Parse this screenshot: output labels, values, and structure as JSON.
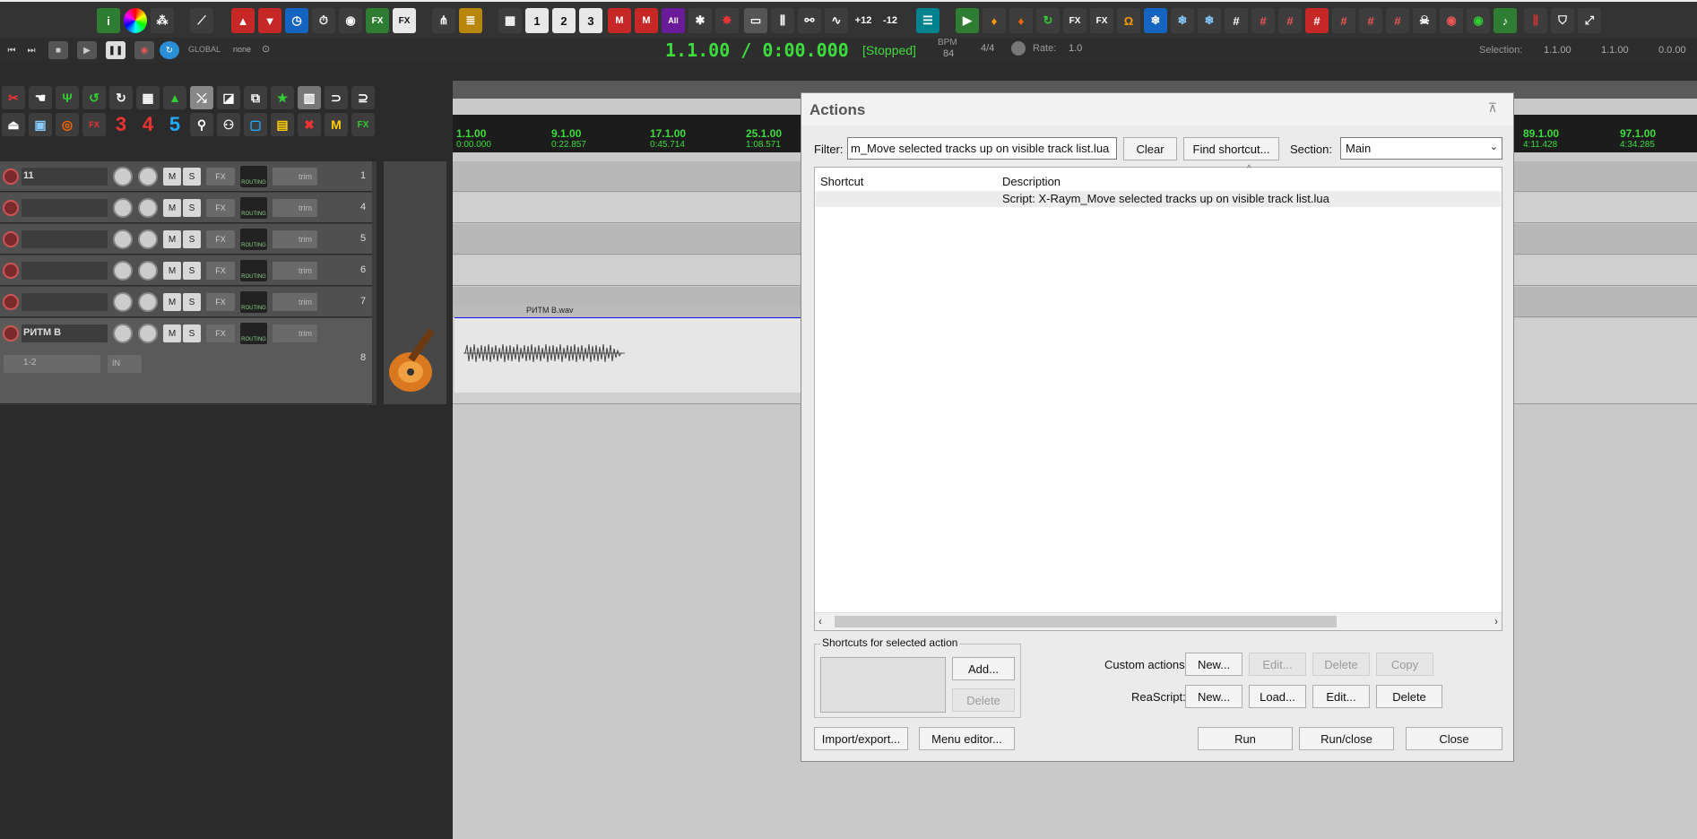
{
  "toolbar": {
    "icons": [
      "info-icon",
      "color-wheel-icon",
      "cluster-icon",
      "envelope-icon",
      "up-arrow-icon",
      "down-arrow-icon",
      "clock-icon",
      "timer-icon",
      "eye-icon",
      "fx-icon",
      "fx-alt-icon",
      "routing-icon",
      "mixer-icon",
      "grid-icon",
      "get-1-icon",
      "get-2-icon",
      "get-3-icon",
      "m-icon",
      "m-x-icon",
      "all-icon",
      "star-x-icon",
      "burst-icon",
      "toggle-icon",
      "fader-icon",
      "link-icon",
      "wave-icon",
      "plus12-icon",
      "minus12-icon",
      "menu-icon",
      "play-green-icon",
      "bell-icon",
      "bell-orange-icon",
      "loop-icon",
      "fx-send-icon",
      "fx-send2-icon",
      "horseshoe-icon",
      "snowflake-icon",
      "snowflake2-icon",
      "snowflake-x-icon",
      "hash-icon",
      "hash1-icon",
      "hash4-icon",
      "hash8-icon",
      "hash16-icon",
      "hash32-icon",
      "hash64-icon",
      "skull-icon",
      "eye-red-icon",
      "eye-green-icon",
      "note-icon",
      "grid-x-icon",
      "shield-icon",
      "expand-icon"
    ],
    "get_labels": [
      "1",
      "2",
      "3"
    ],
    "all_label": "All",
    "plus12": "+12",
    "minus12": "-12"
  },
  "transport": {
    "time": "1.1.00 / 0:00.000",
    "state": "[Stopped]",
    "global_label": "GLOBAL",
    "global_value": "none",
    "bpm_label": "BPM",
    "bpm_value": "84",
    "signature": "4/4",
    "rate_label": "Rate:",
    "rate_value": "1.0",
    "selection_label": "Selection:",
    "selection_start": "1.1.00",
    "selection_end": "1.1.00",
    "selection_length": "0.0.00"
  },
  "second_toolbar": {
    "numbers": [
      "3",
      "4",
      "5"
    ],
    "fx_label": "FX"
  },
  "tracks": [
    {
      "name": "11",
      "number": "1"
    },
    {
      "name": "",
      "number": "4"
    },
    {
      "name": "",
      "number": "5"
    },
    {
      "name": "",
      "number": "6"
    },
    {
      "name": "",
      "number": "7"
    },
    {
      "name": "РИТМ В",
      "number": "8",
      "io": "1-2",
      "in": "IN"
    }
  ],
  "track_buttons": {
    "mute": "M",
    "solo": "S",
    "fx": "FX",
    "routing": "ROUTING",
    "trim": "trim"
  },
  "ruler": {
    "marks": [
      {
        "bar": "1.1.00",
        "time": "0:00.000"
      },
      {
        "bar": "9.1.00",
        "time": "0:22.857"
      },
      {
        "bar": "17.1.00",
        "time": "0:45.714"
      },
      {
        "bar": "25.1.00",
        "time": "1:08.571"
      },
      {
        "bar": "89.1.00",
        "time": "4:11.428"
      },
      {
        "bar": "97.1.00",
        "time": "4:34.285"
      }
    ]
  },
  "media_item": {
    "name": "РИТМ В.wav"
  },
  "actions_dialog": {
    "title": "Actions",
    "filter_label": "Filter:",
    "filter_value": "m_Move selected tracks up on visible track list.lua",
    "clear_label": "Clear",
    "find_shortcut_label": "Find shortcut...",
    "section_label": "Section:",
    "section_value": "Main",
    "columns": {
      "shortcut": "Shortcut",
      "description": "Description"
    },
    "rows": [
      {
        "shortcut": "",
        "description": "Script: X-Raym_Move selected tracks up on visible track list.lua"
      }
    ],
    "shortcuts_group_label": "Shortcuts for selected action",
    "add_label": "Add...",
    "delete_label": "Delete",
    "custom_actions_label": "Custom actions:",
    "custom_new": "New...",
    "custom_edit": "Edit...",
    "custom_delete": "Delete",
    "custom_copy": "Copy",
    "reascript_label": "ReaScript:",
    "reascript_new": "New...",
    "reascript_load": "Load...",
    "reascript_edit": "Edit...",
    "reascript_delete": "Delete",
    "import_export": "Import/export...",
    "menu_editor": "Menu editor...",
    "run": "Run",
    "run_close": "Run/close",
    "close": "Close"
  }
}
